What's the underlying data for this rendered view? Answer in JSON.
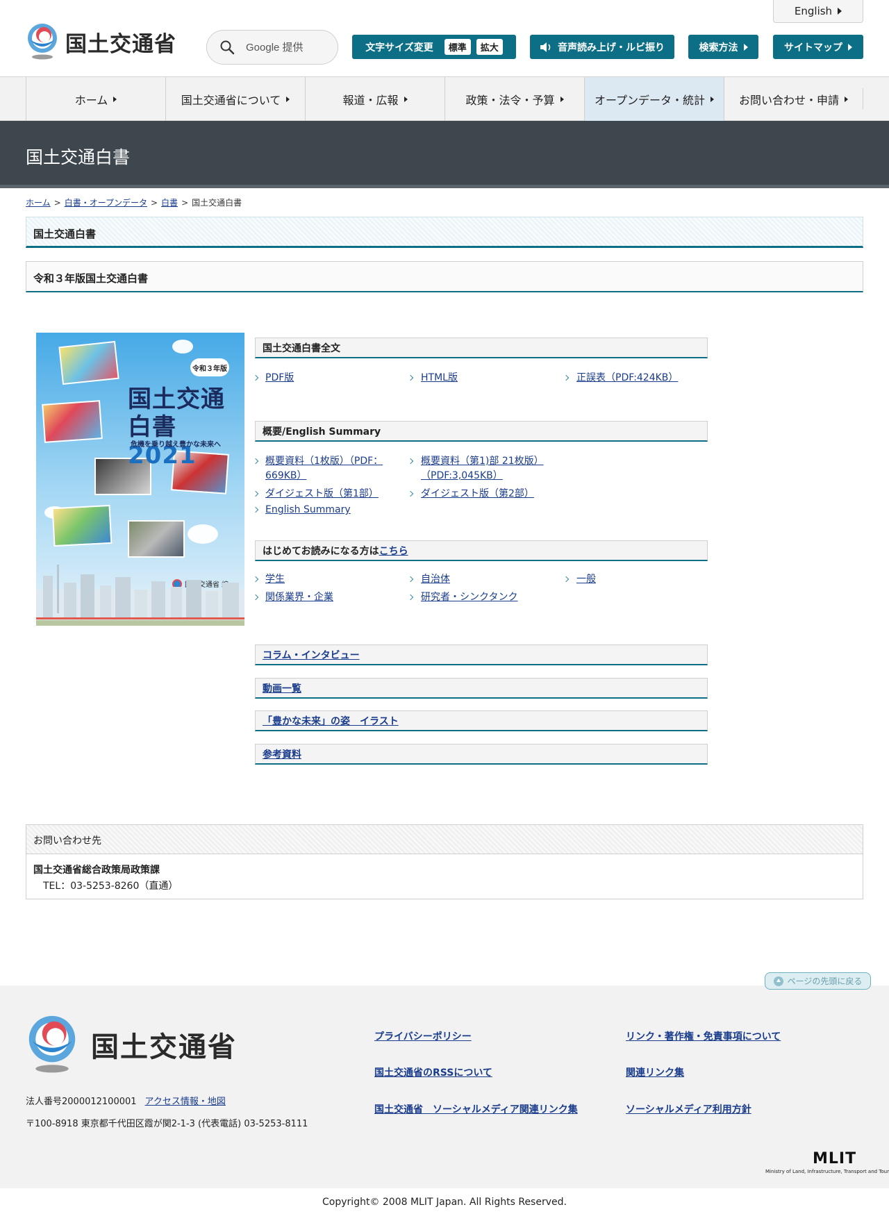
{
  "header": {
    "logo_text": "国土交通省",
    "search": {
      "placeholder": "Google 提供"
    },
    "english": "English",
    "font_size": {
      "label": "文字サイズ変更",
      "standard": "標準",
      "large": "拡大"
    },
    "speech": "音声読み上げ・ルビ振り",
    "search_method": "検索方法",
    "sitemap": "サイトマップ"
  },
  "nav": {
    "items": [
      {
        "label": "ホーム"
      },
      {
        "label": "国土交通省について"
      },
      {
        "label": "報道・広報"
      },
      {
        "label": "政策・法令・予算"
      },
      {
        "label": "オープンデータ・統計"
      },
      {
        "label": "お問い合わせ・申請"
      }
    ]
  },
  "page": {
    "title": "国土交通白書",
    "breadcrumb": [
      {
        "label": "ホーム"
      },
      {
        "label": "白書・オープンデータ"
      },
      {
        "label": "白書"
      },
      {
        "label": "国土交通白書"
      }
    ],
    "h2": "国土交通白書",
    "h3": "令和３年版国土交通白書"
  },
  "cover": {
    "badge": "令和３年版",
    "title_line1": "国土交通",
    "title_line2": "白書",
    "year": "2021",
    "subtitle": "危機を乗り越え豊かな未来へ",
    "publisher": "国土交通省 編"
  },
  "sections": {
    "fulltext": {
      "heading": "国土交通白書全文",
      "links": [
        "PDF版",
        "HTML版",
        "正誤表（PDF:424KB）"
      ]
    },
    "summary": {
      "heading": "概要/English Summary",
      "links": [
        {
          "line1": "概要資料（1枚版）（PDF：",
          "line2": "669KB）"
        },
        {
          "line1": "概要資料（第1)部 21枚版）",
          "line2": "（PDF:3,045KB）"
        },
        {
          "line1": "ダイジェスト版（第1部）"
        },
        {
          "line1": "ダイジェスト版（第2部）"
        },
        {
          "line1": "English Summary"
        }
      ]
    },
    "first_time": {
      "heading_prefix": "はじめてお読みになる方は",
      "heading_link": "こちら",
      "links": [
        "学生",
        "自治体",
        "一般",
        "関係業界・企業",
        "研究者・シンクタンク"
      ]
    },
    "extra": [
      "コラム・インタビュー",
      "動画一覧",
      "「豊かな未来」の姿　イラスト",
      "参考資料"
    ]
  },
  "contact": {
    "heading": "お問い合わせ先",
    "org": "国土交通省総合政策局政策課",
    "tel": "TEL：03-5253-8260（直通）"
  },
  "back_to_top": "ページの先頭に戻る",
  "footer": {
    "logo_text": "国土交通省",
    "corp_number": "法人番号2000012100001",
    "access": "アクセス情報・地図",
    "address": "〒100-8918 東京都千代田区霞が関2-1-3 (代表電話) 03-5253-8111",
    "links": [
      "プライバシーポリシー",
      "リンク・著作権・免責事項について",
      "国土交通省のRSSについて",
      "関連リンク集",
      "国土交通省　ソーシャルメディア関連リンク集",
      "ソーシャルメディア利用方針"
    ],
    "mlit": "MLIT",
    "mlit_sub": "Ministry of Land, Infrastructure, Transport and Tourism",
    "copyright": "Copyright© 2008 MLIT Japan. All Rights Reserved."
  },
  "colors": {
    "accent": "#0c6f86",
    "title_band": "#3d474d",
    "link": "#1a3c8c"
  }
}
